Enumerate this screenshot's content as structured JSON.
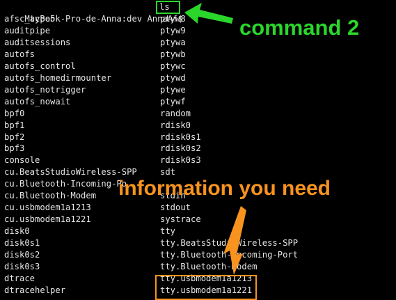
{
  "terminal": {
    "prompt": "MacBook-Pro-de-Anna:dev AnnaAf$",
    "command": "ls",
    "rows": [
      [
        "afsc_type5",
        "ptyw8"
      ],
      [
        "auditpipe",
        "ptyw9"
      ],
      [
        "auditsessions",
        "ptywa"
      ],
      [
        "autofs",
        "ptywb"
      ],
      [
        "autofs_control",
        "ptywc"
      ],
      [
        "autofs_homedirmounter",
        "ptywd"
      ],
      [
        "autofs_notrigger",
        "ptywe"
      ],
      [
        "autofs_nowait",
        "ptywf"
      ],
      [
        "bpf0",
        "random"
      ],
      [
        "bpf1",
        "rdisk0"
      ],
      [
        "bpf2",
        "rdisk0s1"
      ],
      [
        "bpf3",
        "rdisk0s2"
      ],
      [
        "console",
        "rdisk0s3"
      ],
      [
        "cu.BeatsStudioWireless-SPP",
        "sdt"
      ],
      [
        "cu.Bluetooth-Incoming-Po",
        ""
      ],
      [
        "cu.Bluetooth-Modem",
        "stdin"
      ],
      [
        "cu.usbmodem1a1213",
        "stdout"
      ],
      [
        "cu.usbmodem1a1221",
        "systrace"
      ],
      [
        "disk0",
        "tty"
      ],
      [
        "disk0s1",
        "tty.BeatsStudioWireless-SPP"
      ],
      [
        "disk0s2",
        "tty.Bluetooth-Incoming-Port"
      ],
      [
        "disk0s3",
        "tty.Bluetooth-Modem"
      ],
      [
        "dtrace",
        "tty.usbmodem1a1213"
      ],
      [
        "dtracehelper",
        "tty.usbmodem1a1221"
      ]
    ]
  },
  "annotations": {
    "command_label": "command 2",
    "info_label": "information you need"
  },
  "colors": {
    "background": "#000000",
    "text": "#e6e6e6",
    "green": "#2bd62b",
    "orange": "#f7931e"
  }
}
